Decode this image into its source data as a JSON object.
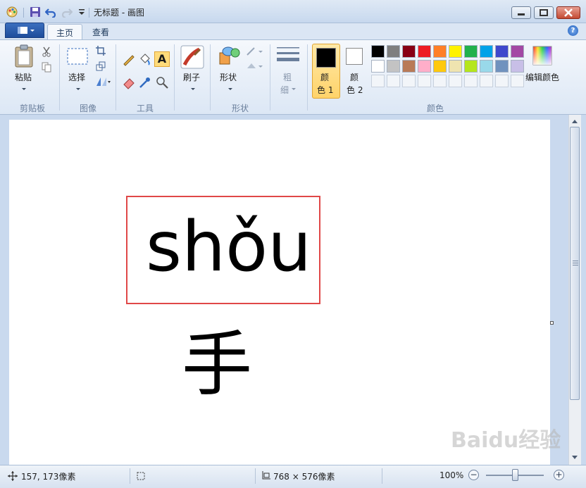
{
  "window": {
    "title": "无标题 - 画图"
  },
  "tabs": [
    {
      "label": "主页",
      "active": true
    },
    {
      "label": "查看",
      "active": false
    }
  ],
  "ribbon": {
    "clipboard": {
      "paste_label": "粘贴",
      "group_label": "剪贴板"
    },
    "image": {
      "select_label": "选择",
      "group_label": "图像"
    },
    "tools": {
      "group_label": "工具"
    },
    "brushes": {
      "label": "刷子"
    },
    "shapes": {
      "label": "形状",
      "group_label": "形状"
    },
    "size": {
      "line1": "粗",
      "line2": "细"
    },
    "colors": {
      "color1_line1": "颜",
      "color1_line2": "色 1",
      "color2_line1": "颜",
      "color2_line2": "色 2",
      "edit_label": "编辑颜色",
      "group_label": "颜色",
      "color1": "#000000",
      "color2": "#ffffff",
      "palette_row1": [
        "#000000",
        "#7f7f7f",
        "#880015",
        "#ed1c24",
        "#ff7f27",
        "#fff200",
        "#22b14c",
        "#00a2e8",
        "#3f48cc",
        "#a349a4"
      ],
      "palette_row2": [
        "#ffffff",
        "#c3c3c3",
        "#b97a57",
        "#ffaec9",
        "#ffc90e",
        "#efe4b0",
        "#b5e61d",
        "#99d9ea",
        "#7092be",
        "#c8bfe7"
      ]
    }
  },
  "canvas": {
    "pinyin_text": "shǒu",
    "hanzi_text": "手",
    "highlight_color": "#e04848"
  },
  "watermark": "Baidu经验",
  "status": {
    "cursor_pos": "157, 173像素",
    "canvas_size": "768 × 576像素",
    "zoom": "100%"
  }
}
